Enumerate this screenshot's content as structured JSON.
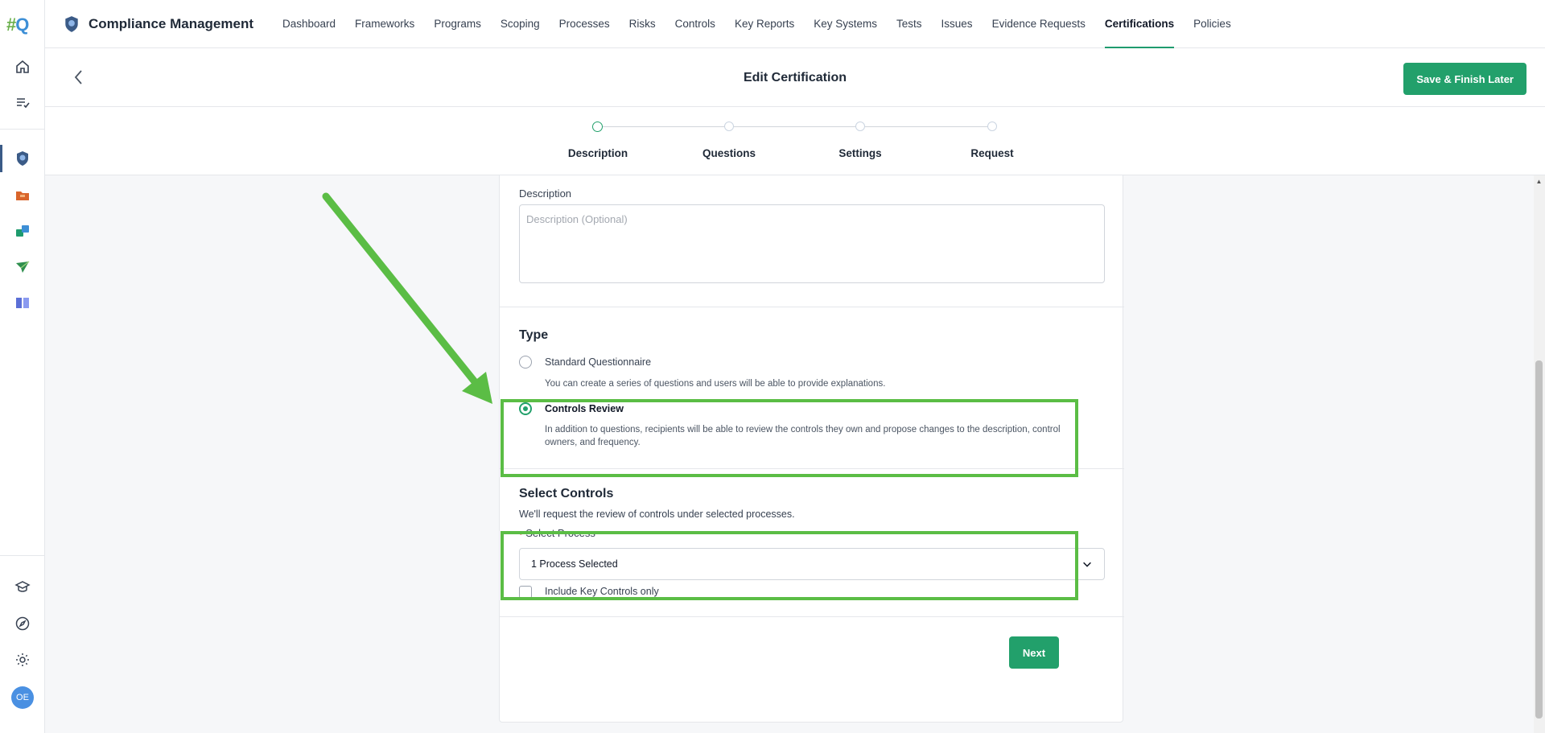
{
  "app": {
    "logo_hash": "#",
    "logo_q": "Q",
    "brand_title": "Compliance Management",
    "user_initials": "OE"
  },
  "nav": {
    "items": [
      {
        "label": "Dashboard"
      },
      {
        "label": "Frameworks"
      },
      {
        "label": "Programs"
      },
      {
        "label": "Scoping"
      },
      {
        "label": "Processes"
      },
      {
        "label": "Risks"
      },
      {
        "label": "Controls"
      },
      {
        "label": "Key Reports"
      },
      {
        "label": "Key Systems"
      },
      {
        "label": "Tests"
      },
      {
        "label": "Issues"
      },
      {
        "label": "Evidence Requests"
      },
      {
        "label": "Certifications"
      },
      {
        "label": "Policies"
      }
    ],
    "active": "Certifications"
  },
  "header": {
    "title": "Edit Certification",
    "save_label": "Save & Finish Later"
  },
  "stepper": {
    "steps": [
      {
        "label": "Description",
        "state": "active"
      },
      {
        "label": "Questions",
        "state": "pending"
      },
      {
        "label": "Settings",
        "state": "pending"
      },
      {
        "label": "Request",
        "state": "pending"
      }
    ]
  },
  "form": {
    "description_label": "Description",
    "description_placeholder": "Description (Optional)",
    "type_title": "Type",
    "options": [
      {
        "title": "Standard Questionnaire",
        "description": "You can create a series of questions and users will be able to provide explanations.",
        "selected": false
      },
      {
        "title": "Controls Review",
        "description": "In addition to questions, recipients will be able to review the controls they own and propose changes to the description, control owners, and frequency.",
        "selected": true
      }
    ],
    "select_controls_title": "Select Controls",
    "select_controls_subtitle": "We'll request the review of controls under selected processes.",
    "required_mark": "•",
    "select_process_label": "Select Process",
    "select_process_value": "1 Process Selected",
    "include_key_controls_label": "Include Key Controls only",
    "include_key_controls_checked": false,
    "next_label": "Next"
  },
  "colors": {
    "accent": "#22a06b",
    "annotation": "#5bbd45",
    "rail_active": "#3b5b87"
  },
  "icons": {
    "rail_top": [
      "home-icon",
      "tasks-icon"
    ],
    "rail_apps": [
      "compliance-badge-icon",
      "folder-icon",
      "sync-icon",
      "send-icon",
      "book-icon"
    ],
    "rail_bottom": [
      "learn-icon",
      "compass-icon",
      "gear-icon"
    ]
  }
}
